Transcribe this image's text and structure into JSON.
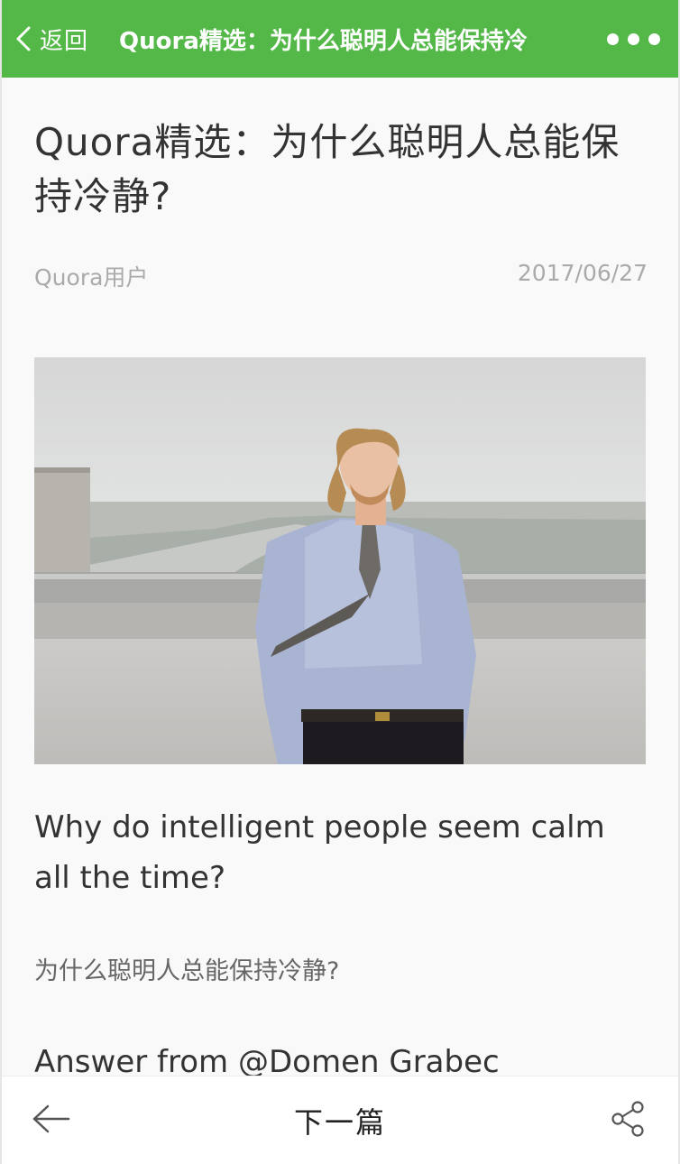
{
  "nav": {
    "back_label": "返回",
    "title": "Quora精选：为什么聪明人总能保持冷",
    "back_icon": "chevron-left-icon",
    "more_icon": "more-dots-icon"
  },
  "article": {
    "title": "Quora精选：为什么聪明人总能保持冷静?",
    "author": "Quora用户",
    "date": "2017/06/27",
    "image_icon": "photo-man-on-rooftop",
    "body_en": "Why do intelligent people seem calm all the time?",
    "body_cn": "为什么聪明人总能保持冷静?",
    "answer_line": "Answer from @Domen Grabec"
  },
  "toolbar": {
    "prev_icon": "arrow-left-icon",
    "next_label": "下一篇",
    "share_icon": "share-icon"
  },
  "colors": {
    "nav_green": "#53b848",
    "text_dark": "#333333",
    "text_meta": "#aaaaaa"
  }
}
